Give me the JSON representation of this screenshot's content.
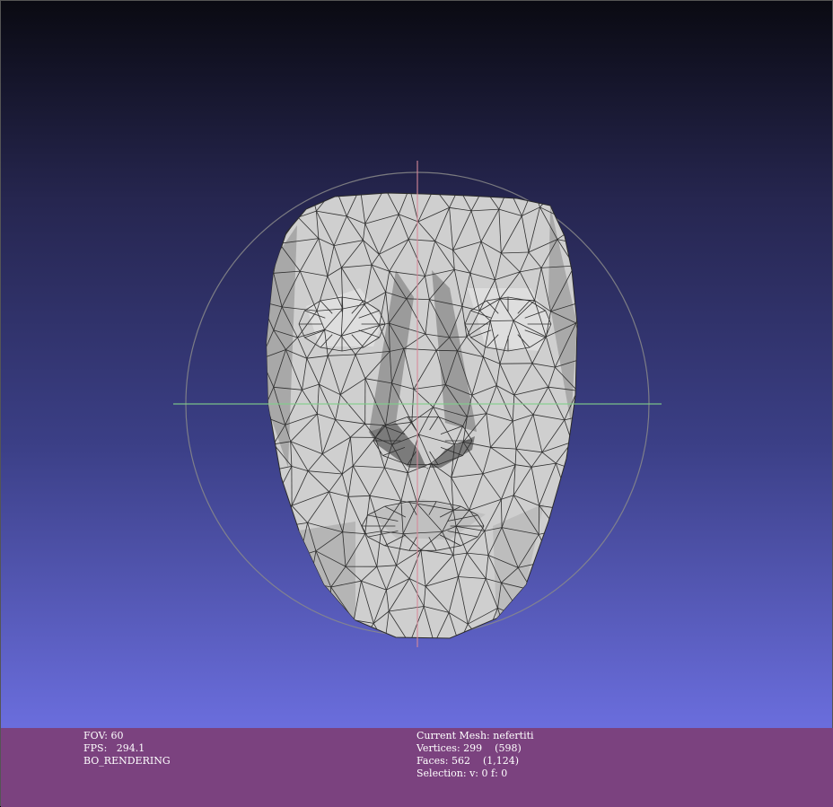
{
  "viewer": {
    "mesh_color": "#cfcfcf",
    "edge_color": "#2a2a2a",
    "trackball_color": "#8a8a8a",
    "axis_horizontal_color": "#7fcf8a",
    "axis_vertical_color": "#d88a9a",
    "background_top": "#0a0a12",
    "background_bottom": "#7073e6"
  },
  "info": {
    "left": {
      "fov_label": "FOV:",
      "fov_value": "60",
      "fps_label": "FPS:",
      "fps_value": "294.1",
      "mode": "BO_RENDERING"
    },
    "right": {
      "mesh_label": "Current Mesh:",
      "mesh_name": "nefertiti",
      "vertices_label": "Vertices:",
      "vertices_value": "299",
      "vertices_extra": "(598)",
      "faces_label": "Faces:",
      "faces_value": "562",
      "faces_extra": "(1,124)",
      "selection_label": "Selection:",
      "selection_value": "v: 0 f: 0"
    }
  }
}
